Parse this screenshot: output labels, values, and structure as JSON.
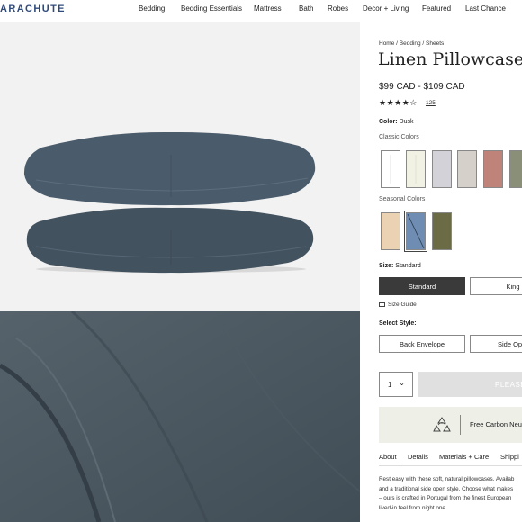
{
  "brand": {
    "logo_text": "ARACHUTE"
  },
  "nav": {
    "items": [
      {
        "label": "Bedding"
      },
      {
        "label": "Bedding Essentials"
      },
      {
        "label": "Mattress"
      },
      {
        "label": "Bath"
      },
      {
        "label": "Robes"
      },
      {
        "label": "Decor + Living"
      },
      {
        "label": "Featured"
      },
      {
        "label": "Last Chance"
      }
    ]
  },
  "breadcrumb": {
    "home": "Home",
    "sep": " / ",
    "bedding": "Bedding",
    "sheets": "Sheets"
  },
  "product": {
    "title": "Linen Pillowcase",
    "price": "$99 CAD - $109 CAD",
    "rating_stars": "★★★★☆",
    "review_count": "125"
  },
  "color": {
    "label": "Color:",
    "selected": "Dusk",
    "classic_label": "Classic Colors",
    "classic": [
      {
        "name": "white",
        "hex": "#ffffff"
      },
      {
        "name": "cream",
        "hex": "#f2f2e4"
      },
      {
        "name": "fog",
        "hex": "#d2d2d8"
      },
      {
        "name": "stone",
        "hex": "#d6d0cb"
      },
      {
        "name": "rose",
        "hex": "#c0837a"
      },
      {
        "name": "moss",
        "hex": "#8a9078"
      }
    ],
    "seasonal_label": "Seasonal Colors",
    "seasonal": [
      {
        "name": "sand",
        "hex": "#ead2b2"
      },
      {
        "name": "dusk",
        "hex": "#6f8db2"
      },
      {
        "name": "olive",
        "hex": "#6b6b45"
      }
    ]
  },
  "size": {
    "label": "Size:",
    "selected": "Standard",
    "options": [
      {
        "label": "Standard"
      },
      {
        "label": "King"
      }
    ],
    "guide": "Size Guide"
  },
  "style": {
    "label": "Select Style:",
    "options": [
      {
        "label": "Back Envelope"
      },
      {
        "label": "Side Op"
      }
    ]
  },
  "purchase": {
    "quantity": "1",
    "chevron": "⌄",
    "add_label": "PLEASE"
  },
  "carbon": {
    "text": "Free Carbon Neu"
  },
  "tabs": [
    {
      "label": "About"
    },
    {
      "label": "Details"
    },
    {
      "label": "Materials + Care"
    },
    {
      "label": "Shippi"
    }
  ],
  "about": {
    "lines": [
      "Rest easy with these soft, natural pillowcases. Availab",
      "and a traditional side open style. Choose what makes",
      "– ours is crafted in Portugal from the finest European",
      "lived-in feel from night one."
    ]
  },
  "theme": {
    "accent": "#3a3a3a",
    "pillow": "#4a5b6b",
    "linen": "#48545d"
  }
}
